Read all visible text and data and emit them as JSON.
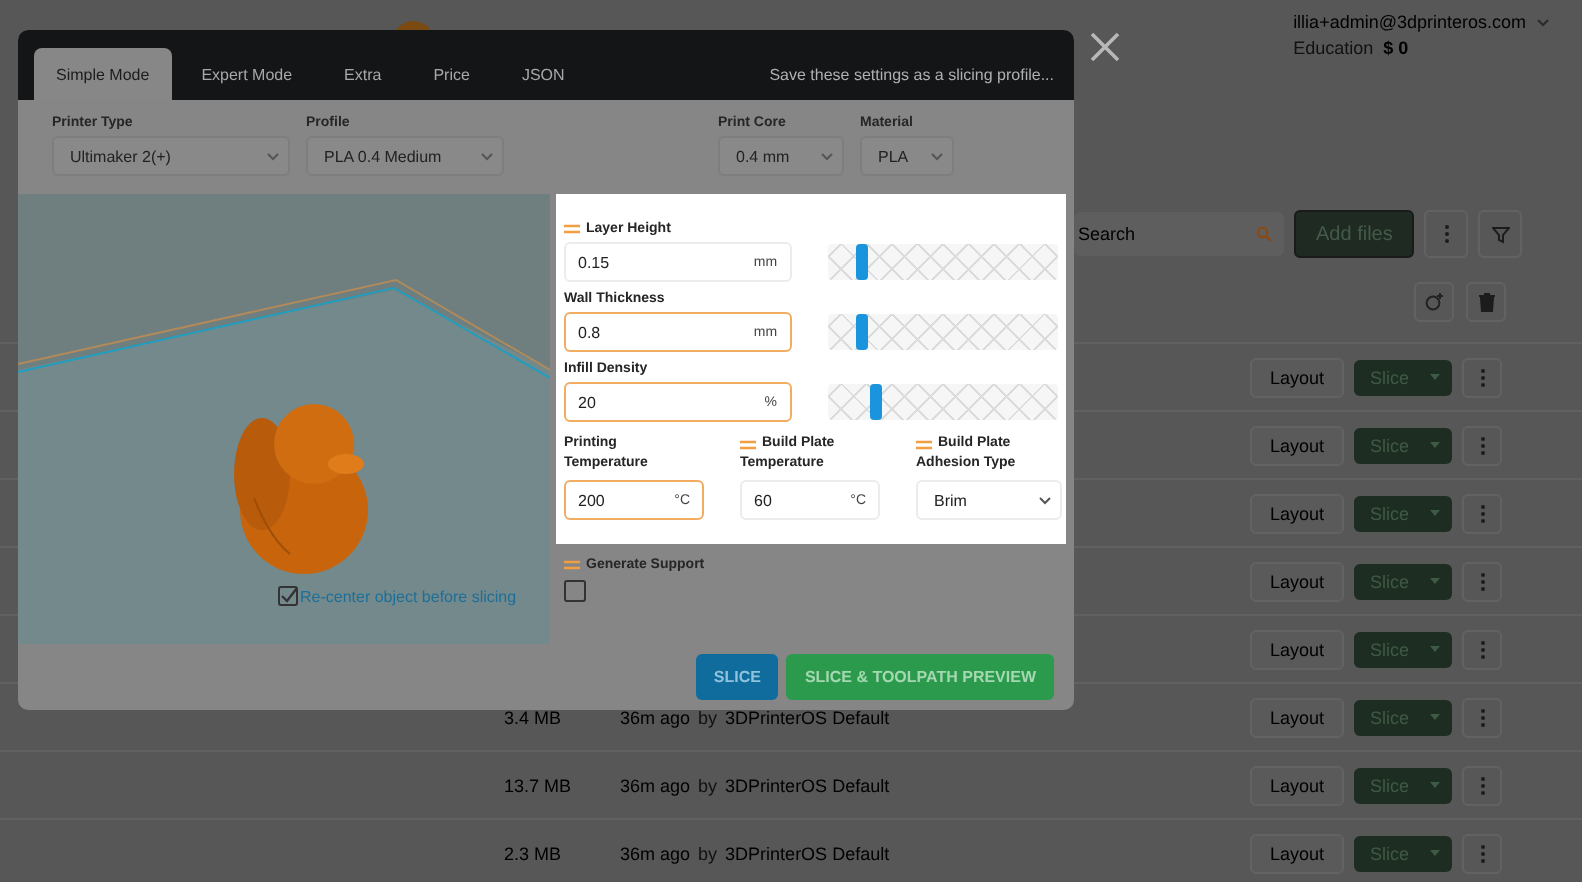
{
  "header": {
    "account": "illia+admin@3dprinteros.com",
    "plan": "Education",
    "balance": "$ 0"
  },
  "search": {
    "placeholder": "Search"
  },
  "add_files": "Add files",
  "files": [
    {
      "layout": "Layout",
      "slice": "Slice"
    },
    {
      "layout": "Layout",
      "slice": "Slice"
    },
    {
      "layout": "Layout",
      "slice": "Slice"
    },
    {
      "layout": "Layout",
      "slice": "Slice"
    },
    {
      "layout": "Layout",
      "slice": "Slice"
    },
    {
      "size": "3.4 MB",
      "age": "36m ago",
      "by": "by",
      "author": "3DPrinterOS Default",
      "layout": "Layout",
      "slice": "Slice"
    },
    {
      "size": "13.7 MB",
      "age": "36m ago",
      "by": "by",
      "author": "3DPrinterOS Default",
      "layout": "Layout",
      "slice": "Slice"
    },
    {
      "size": "2.3 MB",
      "age": "36m ago",
      "by": "by",
      "author": "3DPrinterOS Default",
      "layout": "Layout",
      "slice": "Slice"
    }
  ],
  "dialog": {
    "tabs": [
      {
        "label": "Simple Mode",
        "selected": true
      },
      {
        "label": "Expert Mode",
        "selected": false
      },
      {
        "label": "Extra",
        "selected": false
      },
      {
        "label": "Price",
        "selected": false
      },
      {
        "label": "JSON",
        "selected": false
      }
    ],
    "save_link": "Save these settings as a slicing profile...",
    "selects": [
      {
        "label": "Printer Type",
        "value": "Ultimaker 2(+)"
      },
      {
        "label": "Profile",
        "value": "PLA 0.4 Medium"
      },
      {
        "label": "Print Core",
        "value": "0.4 mm"
      },
      {
        "label": "Material",
        "value": "PLA"
      }
    ],
    "viewer": {
      "kind": "picture",
      "recenter": {
        "label": "Re-center object before slicing",
        "checked": true
      }
    },
    "sliders": [
      {
        "label": "Layer Height",
        "marked": true,
        "value": "0.15",
        "unit": "mm",
        "highlighted": false,
        "level": 0.15
      },
      {
        "label": "Wall Thickness",
        "marked": false,
        "value": "0.8",
        "unit": "mm",
        "highlighted": true,
        "level": 0.15
      },
      {
        "label": "Infill Density",
        "marked": false,
        "value": "20",
        "unit": "%",
        "highlighted": true,
        "level": 0.21
      }
    ],
    "fields": [
      {
        "kind": "number",
        "label": "Printing Temperature",
        "marked": false,
        "value": "200",
        "unit": "°C",
        "highlighted": true
      },
      {
        "kind": "number",
        "label": "Build Plate Temperature",
        "marked": true,
        "value": "60",
        "unit": "°C",
        "highlighted": false
      },
      {
        "kind": "select",
        "label": "Build Plate Adhesion Type",
        "marked": true,
        "value": "Brim"
      }
    ],
    "generate_support": {
      "label": "Generate Support",
      "marked": true,
      "checked": false
    },
    "buttons": [
      {
        "label": "SLICE",
        "kind": "primary"
      },
      {
        "label": "SLICE & TOOLPATH PREVIEW",
        "kind": "success"
      }
    ]
  }
}
